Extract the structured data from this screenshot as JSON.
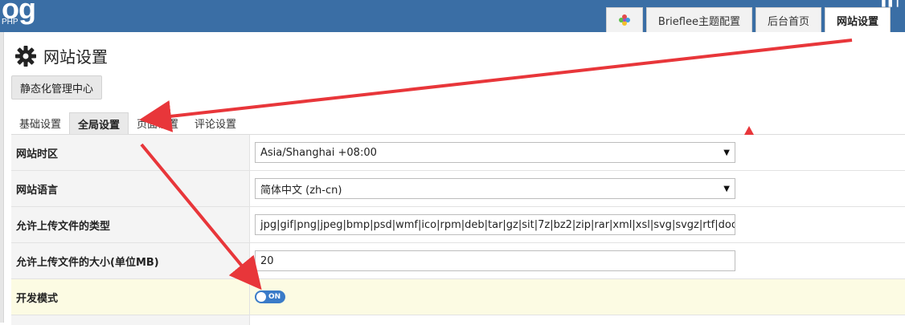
{
  "header": {
    "logo_text": "og",
    "logo_sub": "PHP",
    "toplinks_text": "▐▐ ┃",
    "tabs": [
      {
        "label": "Brieflee主题配置"
      },
      {
        "label": "后台首页"
      },
      {
        "label": "网站设置",
        "active": true
      }
    ]
  },
  "page": {
    "title": "网站设置",
    "static_button": "静态化管理中心",
    "subtabs": [
      {
        "label": "基础设置"
      },
      {
        "label": "全局设置",
        "active": true
      },
      {
        "label": "页面设置"
      },
      {
        "label": "评论设置"
      }
    ]
  },
  "settings": [
    {
      "label": "网站时区",
      "type": "select",
      "value": "Asia/Shanghai +08:00"
    },
    {
      "label": "网站语言",
      "type": "select",
      "value": "简体中文 (zh-cn)"
    },
    {
      "label": "允许上传文件的类型",
      "type": "text",
      "value": "jpg|gif|png|jpeg|bmp|psd|wmf|ico|rpm|deb|tar|gz|sit|7z|bz2|zip|rar|xml|xsl|svg|svgz|rtf|doc|docx|ppt|pptx|xls|xlsx"
    },
    {
      "label": "允许上传文件的大小(单位MB)",
      "type": "text",
      "value": "20"
    },
    {
      "label": "开发模式",
      "type": "toggle",
      "value": "ON"
    }
  ],
  "colors": {
    "topbar": "#3a6ea5",
    "annotation_arrow": "#e8363a",
    "toggle_on": "#3a7bc8",
    "highlight_row": "#fcfbe3"
  }
}
